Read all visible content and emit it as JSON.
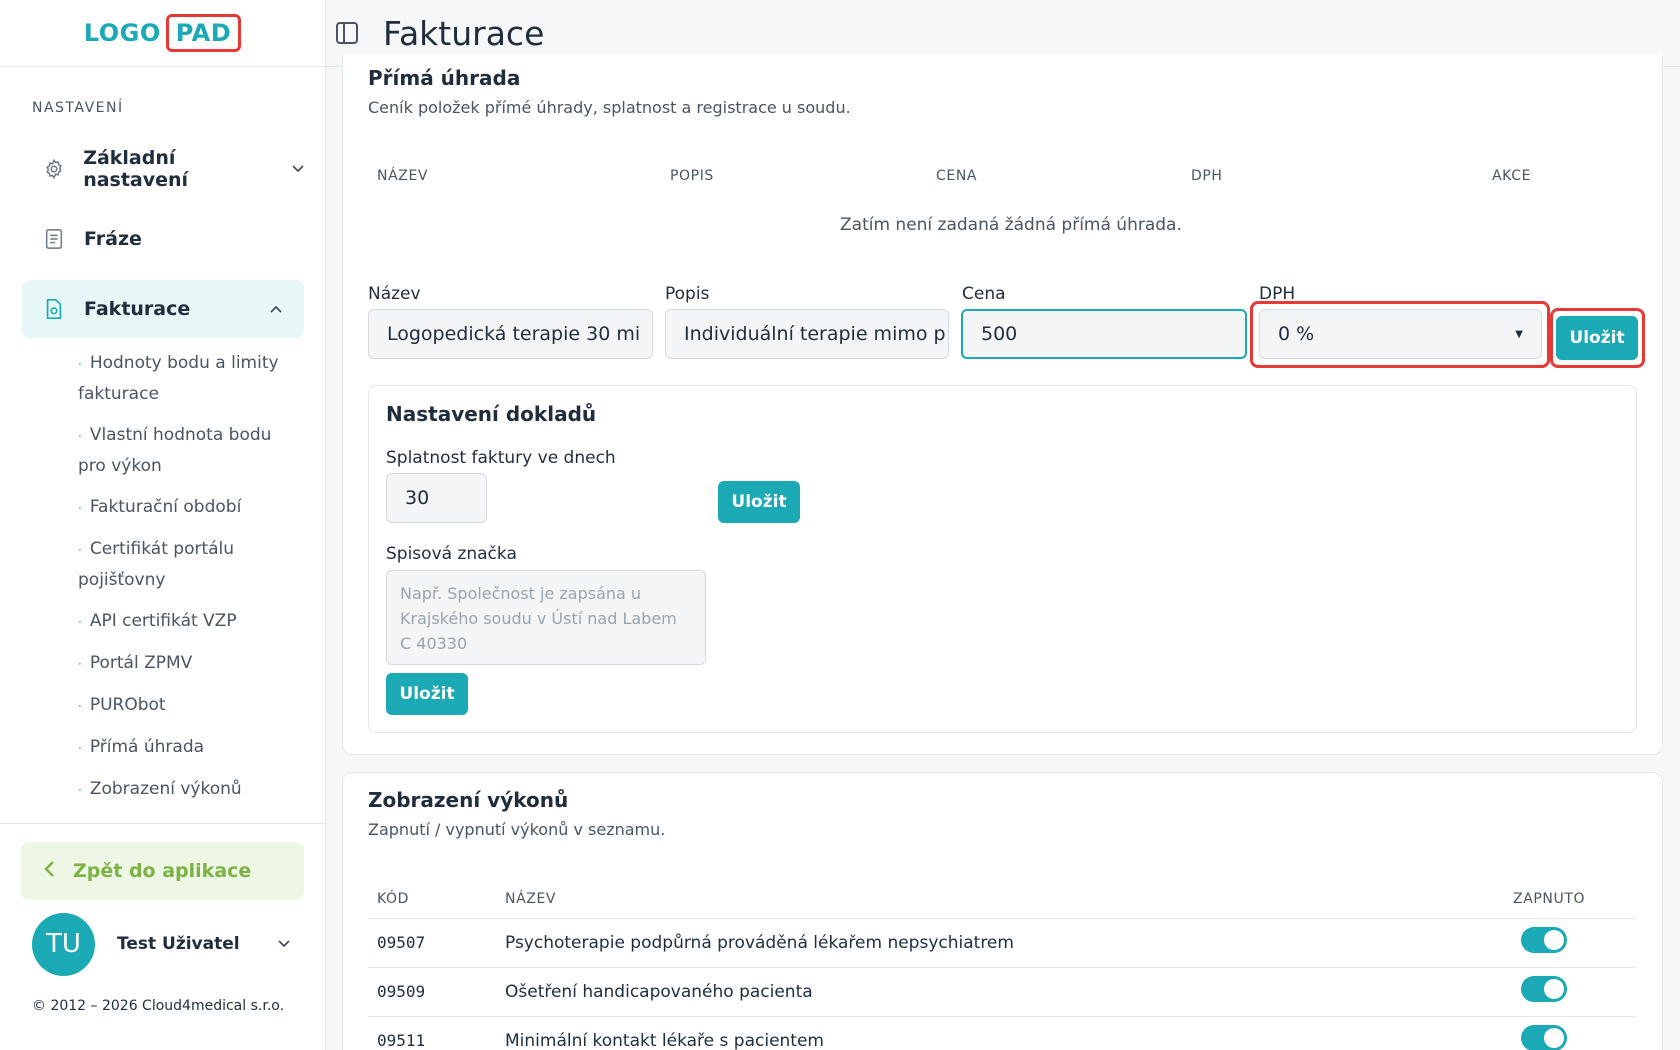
{
  "logo": {
    "part1": "LOGO",
    "part2": "PAD"
  },
  "sidebar": {
    "section_label": "NASTAVENÍ",
    "items": [
      {
        "label": "Základní nastavení",
        "icon": "gear-icon"
      },
      {
        "label": "Fráze",
        "icon": "document-icon"
      },
      {
        "label": "Fakturace",
        "icon": "invoice-icon"
      }
    ],
    "sub_items": [
      "Hodnoty bodu a limity fakturace",
      "Vlastní hodnota bodu pro výkon",
      "Fakturační období",
      "Certifikát portálu pojišťovny",
      "API certifikát VZP",
      "Portál ZPMV",
      "PURObot",
      "Přímá úhrada",
      "Zobrazení výkonů"
    ],
    "back_label": "Zpět do aplikace",
    "user": {
      "initials": "TU",
      "name": "Test Uživatel"
    },
    "copyright": "© 2012 – 2026 Cloud4medical s.r.o."
  },
  "header": {
    "title": "Fakturace"
  },
  "direct_payment": {
    "title": "Přímá úhrada",
    "subtitle": "Ceník položek přímé úhrady, splatnost a registrace u soudu.",
    "columns": [
      "NÁZEV",
      "POPIS",
      "CENA",
      "DPH",
      "AKCE"
    ],
    "empty_message": "Zatím není zadaná žádná přímá úhrada.",
    "form": {
      "name_label": "Název",
      "name_value": "Logopedická terapie 30 mi",
      "desc_label": "Popis",
      "desc_value": "Individuální terapie mimo p",
      "price_label": "Cena",
      "price_value": "500",
      "vat_label": "DPH",
      "vat_value": "0 %",
      "save_label": "Uložit"
    }
  },
  "documents": {
    "title": "Nastavení dokladů",
    "due_label": "Splatnost faktury ve dnech",
    "due_value": "30",
    "save_label": "Uložit",
    "file_label": "Spisová značka",
    "file_placeholder": "Např. Společnost je zapsána u Krajského soudu v Ústí nad Labem C 40330",
    "file_save_label": "Uložit"
  },
  "services": {
    "title": "Zobrazení výkonů",
    "subtitle": "Zapnutí / vypnutí výkonů v seznamu.",
    "columns": [
      "KÓD",
      "NÁZEV",
      "ZAPNUTO"
    ],
    "rows": [
      {
        "code": "09507",
        "name": "Psychoterapie podpůrná prováděná lékařem nepsychiatrem",
        "enabled": true
      },
      {
        "code": "09509",
        "name": "Ošetření handicapovaného pacienta",
        "enabled": true
      },
      {
        "code": "09511",
        "name": "Minimální kontakt lékaře s pacientem",
        "enabled": true
      }
    ]
  },
  "colors": {
    "accent": "#1aa9b5",
    "highlight": "#e53935",
    "back_green": "#7cb342"
  }
}
